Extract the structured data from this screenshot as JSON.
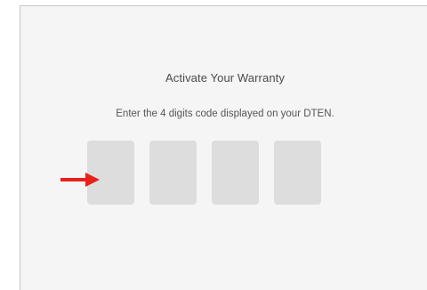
{
  "warranty": {
    "title": "Activate Your Warranty",
    "instruction": "Enter the 4 digits code displayed on your DTEN.",
    "code_inputs": [
      {
        "value": ""
      },
      {
        "value": ""
      },
      {
        "value": ""
      },
      {
        "value": ""
      }
    ]
  },
  "annotation": {
    "icon": "arrow-right-icon",
    "color": "#e8201c"
  },
  "colors": {
    "panel_bg": "#f5f5f5",
    "input_bg": "#dddddd"
  }
}
